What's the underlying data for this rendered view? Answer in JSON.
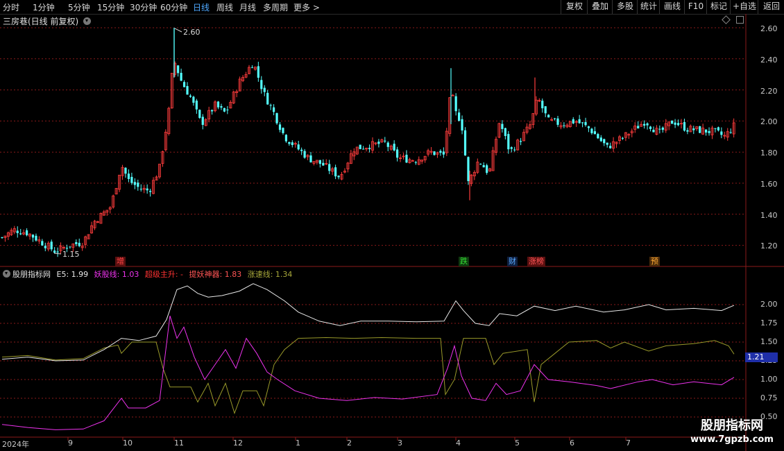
{
  "toolbar": {
    "periods": [
      "分时",
      "1分钟",
      "5分钟",
      "15分钟",
      "30分钟",
      "60分钟",
      "日线",
      "周线",
      "月线",
      "多周期",
      "更多"
    ],
    "active_period": "日线",
    "right_buttons": [
      "复权",
      "叠加",
      "多股",
      "统计",
      "画线",
      "F10",
      "标记",
      "+自选",
      "返回"
    ]
  },
  "main": {
    "title": "三房巷(日线 前复权)",
    "high_label": "2.60",
    "low_label": "1.15",
    "y_ticks": [
      "2.60",
      "2.40",
      "2.20",
      "2.00",
      "1.80",
      "1.60",
      "1.40",
      "1.20"
    ],
    "signals": [
      {
        "text": "增",
        "color": "#ff4444",
        "bg": "#5a1010"
      },
      {
        "text": "跌",
        "color": "#33dd33",
        "bg": "#0f3a0f"
      },
      {
        "text": "财",
        "color": "#5aaaff",
        "bg": "#0f2040"
      },
      {
        "text": "涨榜",
        "color": "#ff5555",
        "bg": "#5a1010"
      },
      {
        "text": "预",
        "color": "#ffaa33",
        "bg": "#4a2a0a"
      }
    ]
  },
  "indicator": {
    "name": "股朋指标网",
    "e5": "E5: 1.99",
    "yao": "妖股线: 1.03",
    "chao": "超级主升: -",
    "ti": "提妖神器: 1.83",
    "zhang": "涨速线: 1.34",
    "y_ticks": [
      "2.00",
      "1.75",
      "1.50",
      "1.25",
      "1.00",
      "0.75",
      "0.50"
    ],
    "cursor_value": "1.21"
  },
  "x_labels": [
    "2024年",
    "9",
    "10",
    "11",
    "12",
    "1",
    "2",
    "3",
    "4",
    "5",
    "6",
    "7"
  ],
  "watermark": {
    "line1": "股朋指标网",
    "line2": "www.7gpzb.com"
  },
  "colors": {
    "up": "#ff3c3c",
    "down": "#54ffff",
    "e5": "#e8e8e8",
    "yao": "#ee33ee",
    "zhang": "#9a9a2a",
    "grid": "#8b1a1a"
  }
}
